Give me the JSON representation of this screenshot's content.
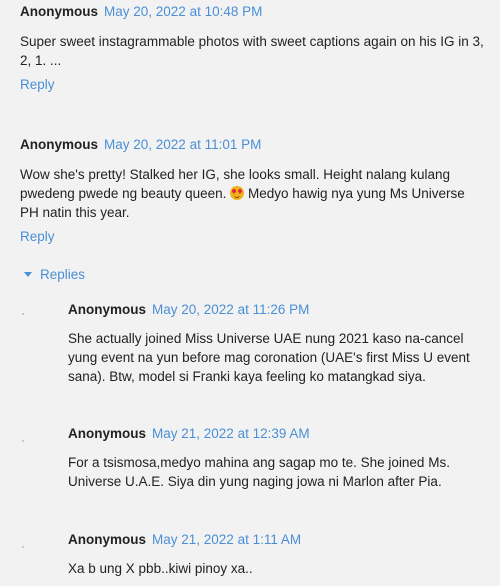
{
  "comments": [
    {
      "author": "Anonymous",
      "date": "May 20, 2022 at 10:48 PM",
      "text": "Super sweet instagrammable photos with sweet captions again on his IG in 3, 2, 1. ...",
      "reply_label": "Reply"
    },
    {
      "author": "Anonymous",
      "date": "May 20, 2022 at 11:01 PM",
      "text_before_emoji": "Wow she's pretty! Stalked her IG, she looks small. Height nalang kulang pwedeng pwede ng beauty queen.",
      "emoji": "heart-eyes-emoji",
      "text_after_emoji": " Medyo hawig nya yung Ms Universe PH natin this year.",
      "reply_label": "Reply"
    }
  ],
  "replies_label": "Replies",
  "replies": [
    {
      "author": "Anonymous",
      "date": "May 20, 2022 at 11:26 PM",
      "text": "She actually joined Miss Universe UAE nung 2021 kaso na-cancel yung event na yun before mag coronation (UAE's first Miss U event sana). Btw, model si Franki kaya feeling ko matangkad siya."
    },
    {
      "author": "Anonymous",
      "date": "May 21, 2022 at 12:39 AM",
      "text": "For a tsismosa,medyo mahina ang sagap mo te. She joined Ms. Universe U.A.E. Siya din yung naging jowa ni Marlon after Pia."
    },
    {
      "author": "Anonymous",
      "date": "May 21, 2022 at 1:11 AM",
      "text": "Xa b ung X pbb..kiwi pinoy xa.."
    }
  ]
}
